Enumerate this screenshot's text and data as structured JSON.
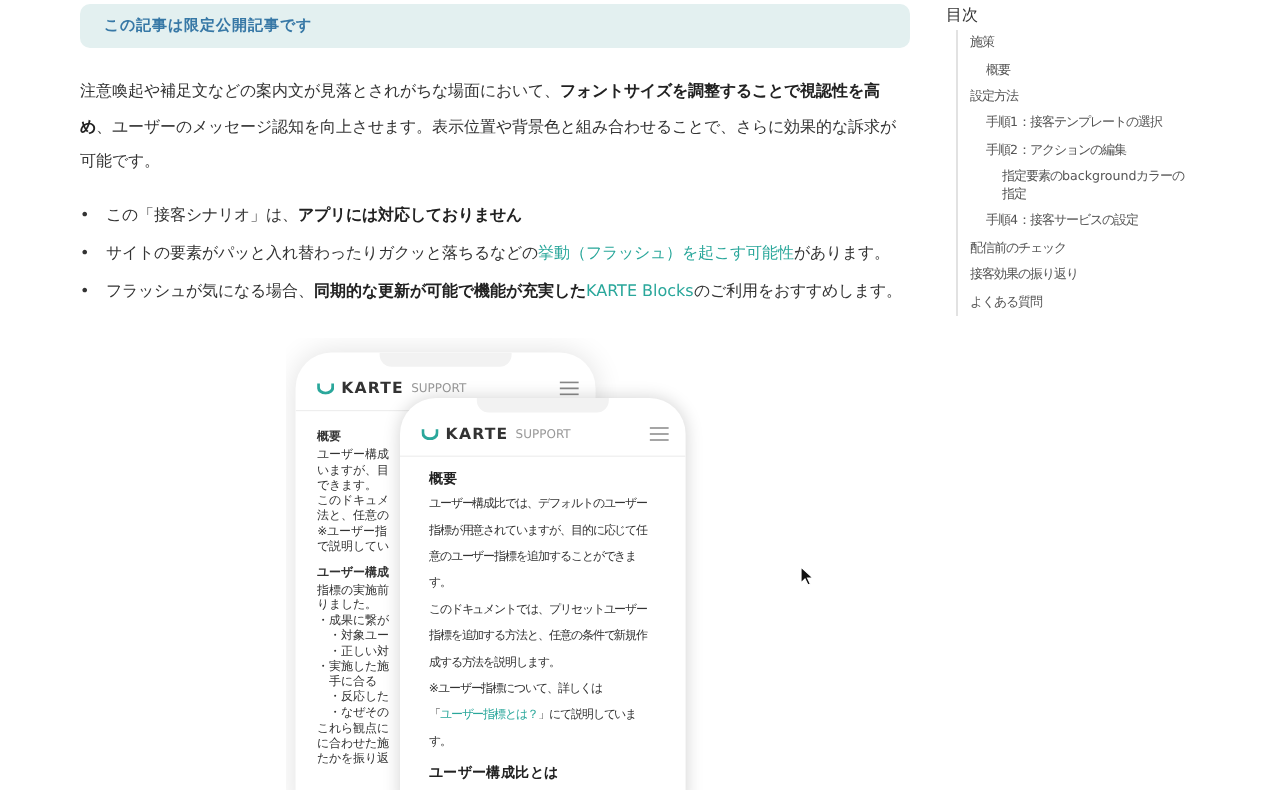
{
  "notice": {
    "text": "この記事は限定公開記事です"
  },
  "intro": [
    {
      "kind": "plain",
      "text": "注意喚起や補足文などの案内文が見落とされがちな場面において、"
    },
    {
      "kind": "bold",
      "text": "フォントサイズを調整することで視認性を高め"
    },
    {
      "kind": "plain",
      "text": "、ユーザーのメッセージ認知を向上させます。表示位置や背景色と組み合わせることで、さらに効果的な訴求が可能です。"
    }
  ],
  "bullets": [
    {
      "marker": "•",
      "segments": [
        {
          "kind": "plain",
          "text": "この「接客シナリオ」は、"
        },
        {
          "kind": "bold",
          "text": "アプリには対応しておりません"
        }
      ]
    },
    {
      "marker": "•",
      "segments": [
        {
          "kind": "plain",
          "text": "サイトの要素がパッと入れ替わったりガクッと落ちるなどの"
        },
        {
          "kind": "link",
          "text": "挙動（フラッシュ）を起こす可能性"
        },
        {
          "kind": "plain",
          "text": "があります。"
        }
      ]
    },
    {
      "marker": "•",
      "segments": [
        {
          "kind": "plain",
          "text": "フラッシュが気になる場合、"
        },
        {
          "kind": "bold",
          "text": "同期的な更新が可能で機能が充実した"
        },
        {
          "kind": "link",
          "text": "KARTE Blocks"
        },
        {
          "kind": "plain",
          "text": "のご利用をおすすめします。"
        }
      ]
    }
  ],
  "mockup": {
    "back_phone": {
      "logo": "KARTE",
      "logo_sub": "SUPPORT",
      "items": [
        {
          "kind": "heading",
          "text": "概要"
        },
        {
          "kind": "line",
          "text": "ユーザー構成"
        },
        {
          "kind": "line",
          "text": "いますが、目"
        },
        {
          "kind": "line",
          "text": "できます。"
        },
        {
          "kind": "line",
          "text": "このドキュメ"
        },
        {
          "kind": "line",
          "text": "法と、任意の"
        },
        {
          "kind": "line",
          "text": "※ユーザー指"
        },
        {
          "kind": "line",
          "text": "で説明してい"
        },
        {
          "kind": "heading",
          "text": "ユーザー構成"
        },
        {
          "kind": "line",
          "text": "指標の実施前"
        },
        {
          "kind": "line",
          "text": "りました。"
        },
        {
          "kind": "line",
          "text": "・成果に繋が"
        },
        {
          "kind": "line",
          "text": "　・対象ユー"
        },
        {
          "kind": "line",
          "text": "　・正しい対"
        },
        {
          "kind": "line",
          "text": "・実施した施"
        },
        {
          "kind": "line",
          "text": "　手に合る"
        },
        {
          "kind": "line",
          "text": "　・反応した"
        },
        {
          "kind": "line",
          "text": "　・なぜその"
        },
        {
          "kind": "line",
          "text": "これら観点に"
        },
        {
          "kind": "line",
          "text": "に合わせた施"
        },
        {
          "kind": "line",
          "text": "たかを振り返"
        }
      ]
    },
    "front_phone": {
      "logo": "KARTE",
      "logo_sub": "SUPPORT",
      "heading": "概要",
      "paragraphs": [
        [
          {
            "kind": "plain",
            "text": "ユーザー構成比では、デフォルトのユーザー指標が用意されていますが、目的に応じて任意のユーザー指標を追加することができます。"
          }
        ],
        [
          {
            "kind": "plain",
            "text": "このドキュメントでは、プリセットユーザー指標を追加する方法と、任意の条件で新規作成する方法を説明します。"
          }
        ],
        [
          {
            "kind": "plain",
            "text": "※ユーザー指標について、詳しくは「"
          },
          {
            "kind": "link",
            "text": "ユーザー指標とは？"
          },
          {
            "kind": "plain",
            "text": "」にて説明しています。"
          }
        ]
      ],
      "subheading": "ユーザー構成比とは"
    }
  },
  "toc": {
    "title": "目次",
    "items": [
      {
        "label": "施策",
        "children": [
          {
            "label": "概要"
          }
        ]
      },
      {
        "label": "設定方法",
        "children": [
          {
            "label": "手順1：接客テンプレートの選択"
          },
          {
            "label": "手順2：アクションの編集",
            "children": [
              {
                "label": "指定要素のbackgroundカラーの指定"
              }
            ]
          },
          {
            "label": "手順4：接客サービスの設定"
          }
        ]
      },
      {
        "label": "配信前のチェック"
      },
      {
        "label": "接客効果の振り返り"
      },
      {
        "label": "よくある質問"
      }
    ]
  }
}
